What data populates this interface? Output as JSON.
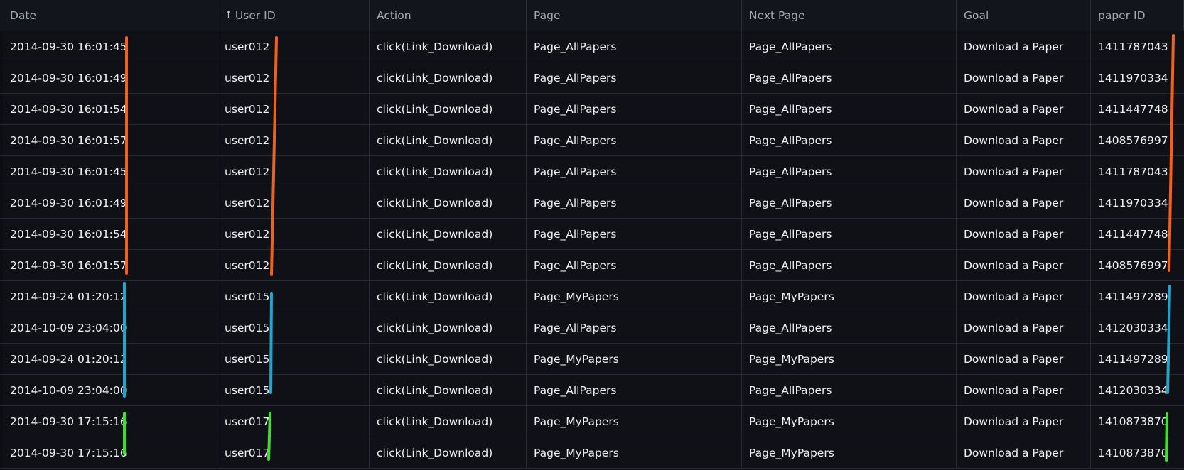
{
  "columns": [
    {
      "label": "Date"
    },
    {
      "label": "User ID",
      "sort_icon": "↑"
    },
    {
      "label": "Action"
    },
    {
      "label": "Page"
    },
    {
      "label": "Next Page"
    },
    {
      "label": "Goal"
    },
    {
      "label": "paper ID"
    }
  ],
  "rows": [
    [
      "2014-09-30 16:01:45",
      "user012",
      "click(Link_Download)",
      "Page_AllPapers",
      "Page_AllPapers",
      "Download a Paper",
      "1411787043"
    ],
    [
      "2014-09-30 16:01:49",
      "user012",
      "click(Link_Download)",
      "Page_AllPapers",
      "Page_AllPapers",
      "Download a Paper",
      "1411970334"
    ],
    [
      "2014-09-30 16:01:54",
      "user012",
      "click(Link_Download)",
      "Page_AllPapers",
      "Page_AllPapers",
      "Download a Paper",
      "1411447748"
    ],
    [
      "2014-09-30 16:01:57",
      "user012",
      "click(Link_Download)",
      "Page_AllPapers",
      "Page_AllPapers",
      "Download a Paper",
      "1408576997"
    ],
    [
      "2014-09-30 16:01:45",
      "user012",
      "click(Link_Download)",
      "Page_AllPapers",
      "Page_AllPapers",
      "Download a Paper",
      "1411787043"
    ],
    [
      "2014-09-30 16:01:49",
      "user012",
      "click(Link_Download)",
      "Page_AllPapers",
      "Page_AllPapers",
      "Download a Paper",
      "1411970334"
    ],
    [
      "2014-09-30 16:01:54",
      "user012",
      "click(Link_Download)",
      "Page_AllPapers",
      "Page_AllPapers",
      "Download a Paper",
      "1411447748"
    ],
    [
      "2014-09-30 16:01:57",
      "user012",
      "click(Link_Download)",
      "Page_AllPapers",
      "Page_AllPapers",
      "Download a Paper",
      "1408576997"
    ],
    [
      "2014-09-24 01:20:12",
      "user015",
      "click(Link_Download)",
      "Page_MyPapers",
      "Page_MyPapers",
      "Download a Paper",
      "1411497289"
    ],
    [
      "2014-10-09 23:04:00",
      "user015",
      "click(Link_Download)",
      "Page_AllPapers",
      "Page_AllPapers",
      "Download a Paper",
      "1412030334"
    ],
    [
      "2014-09-24 01:20:12",
      "user015",
      "click(Link_Download)",
      "Page_MyPapers",
      "Page_MyPapers",
      "Download a Paper",
      "1411497289"
    ],
    [
      "2014-10-09 23:04:00",
      "user015",
      "click(Link_Download)",
      "Page_AllPapers",
      "Page_AllPapers",
      "Download a Paper",
      "1412030334"
    ],
    [
      "2014-09-30 17:15:16",
      "user017",
      "click(Link_Download)",
      "Page_MyPapers",
      "Page_MyPapers",
      "Download a Paper",
      "1410873870"
    ],
    [
      "2014-09-30 17:15:16",
      "user017",
      "click(Link_Download)",
      "Page_MyPapers",
      "Page_MyPapers",
      "Download a Paper",
      "1410873870"
    ]
  ],
  "group_colors": {
    "user012": "#f0601e",
    "user015": "#1fa6cf",
    "user017": "#3ee02c"
  }
}
